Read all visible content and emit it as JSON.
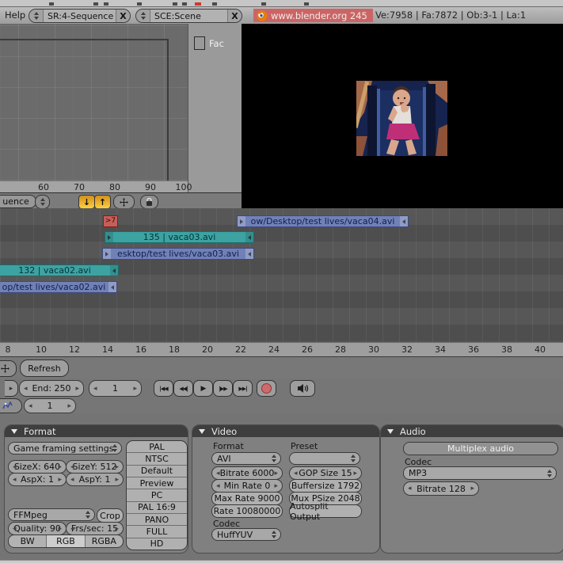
{
  "colors": {
    "accent_orange": "#e8a33d",
    "strip_teal": "#3da2a2",
    "strip_blue": "#7181b7",
    "strip_red": "#c45f5a",
    "badge_pink": "#cb6565",
    "record_red": "#d06a6a",
    "panel_header_gray": "#3e3e3e"
  },
  "icons": {
    "dropdown_stepper": "double-triangle",
    "stepper_left": "◂",
    "stepper_right": "▸",
    "panel_collapse": "▼",
    "snap_down": "↓",
    "snap_up": "↑",
    "pan": "cross-arrows",
    "lock": "padlock",
    "record": "red-circle",
    "speaker": "speaker-shape"
  },
  "info_header": {
    "help_menu": "Help",
    "screen_browser": {
      "value": "SR:4-Sequence",
      "close_label": "X"
    },
    "scene_browser": {
      "value": "SCE:Scene",
      "close_label": "X"
    },
    "version_badge": "www.blender.org 245",
    "stats": "Ve:7958 | Fa:7872 | Ob:3-1 | La:1"
  },
  "ipo_editor": {
    "channel_panel": {
      "channel_label": "Fac"
    },
    "ruler_ticks": [
      "60",
      "70",
      "80",
      "90",
      "100"
    ],
    "header": {
      "editor_type_value": "uence"
    }
  },
  "sequencer": {
    "strips": {
      "effect": {
        "label": ">7"
      },
      "vaca04_path": {
        "label": "ow/Desktop/test lives/vaca04.avi"
      },
      "vaca03_movie": {
        "label": "135 | vaca03.avi"
      },
      "vaca03_path": {
        "label": "esktop/test lives/vaca03.avi"
      },
      "vaca02_movie": {
        "label": "132 | vaca02.avi"
      },
      "vaca02_path": {
        "label": "op/test lives/vaca02.avi"
      }
    },
    "ruler_ticks": [
      "8",
      "10",
      "12",
      "14",
      "16",
      "18",
      "20",
      "22",
      "24",
      "26",
      "28",
      "30",
      "32",
      "34",
      "36",
      "38",
      "40"
    ],
    "header": {
      "refresh_button": "Refresh"
    }
  },
  "timeline": {
    "end_field": "End: 250",
    "frame_field": "1",
    "transport": [
      {
        "name": "jump-to-start",
        "glyph": "|◀◀"
      },
      {
        "name": "prev-frame",
        "glyph": "◀◀|"
      },
      {
        "name": "play",
        "glyph": "▶"
      },
      {
        "name": "next-frame",
        "glyph": "|▶▶"
      },
      {
        "name": "jump-to-end",
        "glyph": "▶▶|"
      }
    ]
  },
  "buttons_header": {
    "frame_field": "1"
  },
  "panels": {
    "format": {
      "title": "Format",
      "game_framing": "Game framing settings",
      "size_x": "SizeX: 640",
      "size_y": "SizeY: 512",
      "asp_x": "AspX: 1",
      "asp_y": "AspY: 1",
      "output_codec": "FFMpeg",
      "crop": "Crop",
      "quality": "Quality: 90",
      "fps": "Frs/sec: 15",
      "bw": "BW",
      "rgb": "RGB",
      "rgba": "RGBA",
      "presets": [
        "PAL",
        "NTSC",
        "Default",
        "Preview",
        "PC",
        "PAL 16:9",
        "PANO",
        "FULL",
        "HD"
      ]
    },
    "video": {
      "title": "Video",
      "format_label": "Format",
      "preset_label": "Preset",
      "format_value": "AVI",
      "preset_value": "",
      "bitrate": "Bitrate 6000",
      "gop_size": "GOP Size 15",
      "min_rate": "Min Rate 0",
      "buffersize": "Buffersize 1792",
      "max_rate": "Max Rate 9000",
      "mux_psize": "Mux PSize 2048",
      "rate": "Rate 10080000",
      "autosplit": "Autosplit Output",
      "codec_label": "Codec",
      "codec_value": "HuffYUV"
    },
    "audio": {
      "title": "Audio",
      "multiplex": "Multiplex audio",
      "codec_label": "Codec",
      "codec_value": "MP3",
      "bitrate": "Bitrate 128"
    }
  }
}
